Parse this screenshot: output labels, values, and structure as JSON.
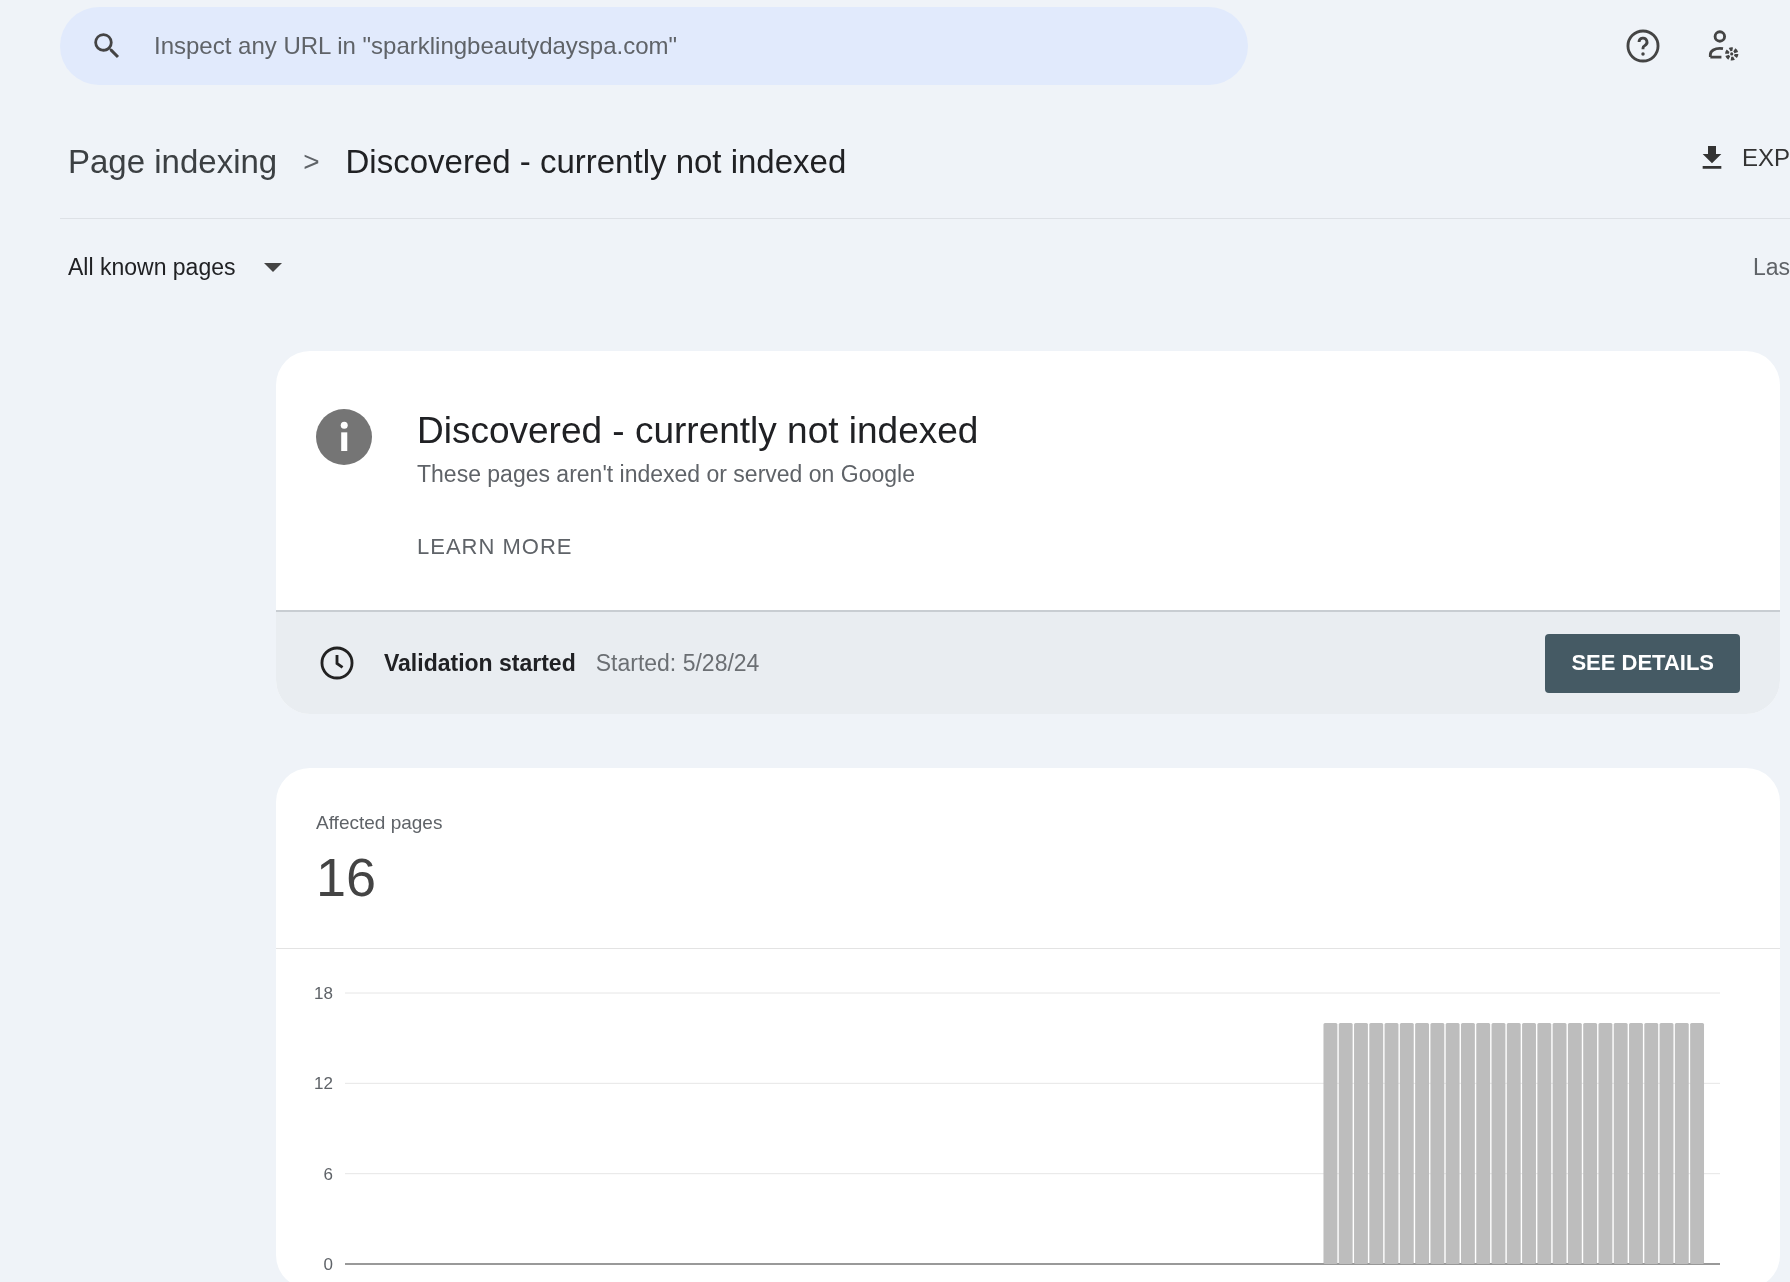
{
  "search": {
    "placeholder": "Inspect any URL in \"sparklingbeautydayspa.com\""
  },
  "breadcrumb": {
    "parent": "Page indexing",
    "separator": ">",
    "current": "Discovered - currently not indexed"
  },
  "export_button": {
    "label": "EXP"
  },
  "filter": {
    "label": "All known pages"
  },
  "date_filter": {
    "label": "Las"
  },
  "issue_card": {
    "title": "Discovered - currently not indexed",
    "description": "These pages aren't indexed or served on Google",
    "link": "LEARN MORE",
    "validation": {
      "status": "Validation started",
      "started": "Started: 5/28/24",
      "button": "SEE DETAILS"
    }
  },
  "affected_card": {
    "label": "Affected pages",
    "count": "16",
    "chart_data": {
      "type": "bar",
      "yticks": [
        0,
        6,
        12,
        18
      ],
      "ylim": [
        0,
        18
      ],
      "series": [
        {
          "color": "#bdbdbd",
          "values": [
            null,
            null,
            null,
            null,
            null,
            null,
            null,
            null,
            null,
            null,
            null,
            null,
            null,
            null,
            null,
            null,
            null,
            null,
            null,
            null,
            null,
            null,
            null,
            null,
            null,
            null,
            null,
            null,
            null,
            null,
            null,
            null,
            null,
            null,
            null,
            null,
            null,
            null,
            null,
            null,
            null,
            null,
            null,
            null,
            null,
            null,
            null,
            null,
            null,
            null,
            null,
            null,
            null,
            null,
            null,
            null,
            null,
            null,
            null,
            null,
            null,
            null,
            null,
            null,
            16,
            16,
            16,
            16,
            16,
            16,
            16,
            16,
            16,
            16,
            16,
            16,
            16,
            16,
            16,
            16,
            16,
            16,
            16,
            16,
            16,
            16,
            16,
            16,
            16,
            null
          ]
        }
      ]
    }
  }
}
